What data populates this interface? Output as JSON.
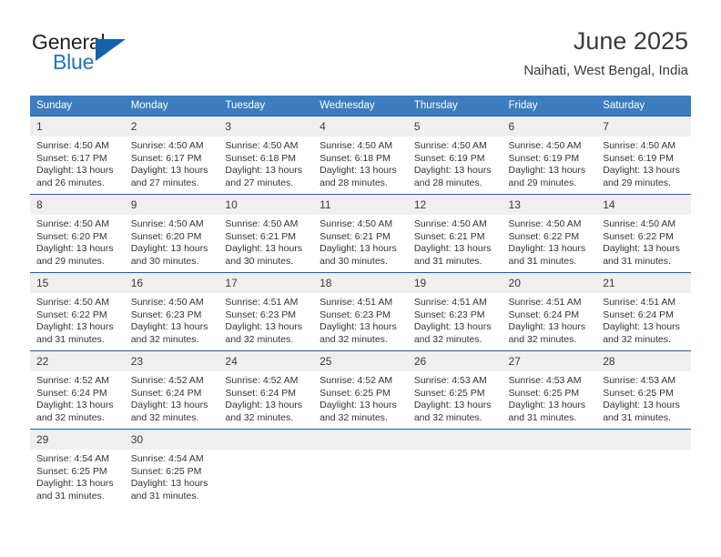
{
  "brand": {
    "name_top": "General",
    "name_bottom": "Blue",
    "triangle_color": "#1161ad",
    "blue_text_color": "#1f76bd"
  },
  "header": {
    "title": "June 2025",
    "subtitle": "Naihati, West Bengal, India"
  },
  "theme": {
    "header_blue": "#3b7dbf",
    "row_divider_blue": "#1b5fa5",
    "daynum_background": "#efefef"
  },
  "calendar": {
    "weekday_headers": [
      "Sunday",
      "Monday",
      "Tuesday",
      "Wednesday",
      "Thursday",
      "Friday",
      "Saturday"
    ],
    "weeks": [
      [
        {
          "day": "1",
          "sunrise": "Sunrise: 4:50 AM",
          "sunset": "Sunset: 6:17 PM",
          "daylight": "Daylight: 13 hours and 26 minutes."
        },
        {
          "day": "2",
          "sunrise": "Sunrise: 4:50 AM",
          "sunset": "Sunset: 6:17 PM",
          "daylight": "Daylight: 13 hours and 27 minutes."
        },
        {
          "day": "3",
          "sunrise": "Sunrise: 4:50 AM",
          "sunset": "Sunset: 6:18 PM",
          "daylight": "Daylight: 13 hours and 27 minutes."
        },
        {
          "day": "4",
          "sunrise": "Sunrise: 4:50 AM",
          "sunset": "Sunset: 6:18 PM",
          "daylight": "Daylight: 13 hours and 28 minutes."
        },
        {
          "day": "5",
          "sunrise": "Sunrise: 4:50 AM",
          "sunset": "Sunset: 6:19 PM",
          "daylight": "Daylight: 13 hours and 28 minutes."
        },
        {
          "day": "6",
          "sunrise": "Sunrise: 4:50 AM",
          "sunset": "Sunset: 6:19 PM",
          "daylight": "Daylight: 13 hours and 29 minutes."
        },
        {
          "day": "7",
          "sunrise": "Sunrise: 4:50 AM",
          "sunset": "Sunset: 6:19 PM",
          "daylight": "Daylight: 13 hours and 29 minutes."
        }
      ],
      [
        {
          "day": "8",
          "sunrise": "Sunrise: 4:50 AM",
          "sunset": "Sunset: 6:20 PM",
          "daylight": "Daylight: 13 hours and 29 minutes."
        },
        {
          "day": "9",
          "sunrise": "Sunrise: 4:50 AM",
          "sunset": "Sunset: 6:20 PM",
          "daylight": "Daylight: 13 hours and 30 minutes."
        },
        {
          "day": "10",
          "sunrise": "Sunrise: 4:50 AM",
          "sunset": "Sunset: 6:21 PM",
          "daylight": "Daylight: 13 hours and 30 minutes."
        },
        {
          "day": "11",
          "sunrise": "Sunrise: 4:50 AM",
          "sunset": "Sunset: 6:21 PM",
          "daylight": "Daylight: 13 hours and 30 minutes."
        },
        {
          "day": "12",
          "sunrise": "Sunrise: 4:50 AM",
          "sunset": "Sunset: 6:21 PM",
          "daylight": "Daylight: 13 hours and 31 minutes."
        },
        {
          "day": "13",
          "sunrise": "Sunrise: 4:50 AM",
          "sunset": "Sunset: 6:22 PM",
          "daylight": "Daylight: 13 hours and 31 minutes."
        },
        {
          "day": "14",
          "sunrise": "Sunrise: 4:50 AM",
          "sunset": "Sunset: 6:22 PM",
          "daylight": "Daylight: 13 hours and 31 minutes."
        }
      ],
      [
        {
          "day": "15",
          "sunrise": "Sunrise: 4:50 AM",
          "sunset": "Sunset: 6:22 PM",
          "daylight": "Daylight: 13 hours and 31 minutes."
        },
        {
          "day": "16",
          "sunrise": "Sunrise: 4:50 AM",
          "sunset": "Sunset: 6:23 PM",
          "daylight": "Daylight: 13 hours and 32 minutes."
        },
        {
          "day": "17",
          "sunrise": "Sunrise: 4:51 AM",
          "sunset": "Sunset: 6:23 PM",
          "daylight": "Daylight: 13 hours and 32 minutes."
        },
        {
          "day": "18",
          "sunrise": "Sunrise: 4:51 AM",
          "sunset": "Sunset: 6:23 PM",
          "daylight": "Daylight: 13 hours and 32 minutes."
        },
        {
          "day": "19",
          "sunrise": "Sunrise: 4:51 AM",
          "sunset": "Sunset: 6:23 PM",
          "daylight": "Daylight: 13 hours and 32 minutes."
        },
        {
          "day": "20",
          "sunrise": "Sunrise: 4:51 AM",
          "sunset": "Sunset: 6:24 PM",
          "daylight": "Daylight: 13 hours and 32 minutes."
        },
        {
          "day": "21",
          "sunrise": "Sunrise: 4:51 AM",
          "sunset": "Sunset: 6:24 PM",
          "daylight": "Daylight: 13 hours and 32 minutes."
        }
      ],
      [
        {
          "day": "22",
          "sunrise": "Sunrise: 4:52 AM",
          "sunset": "Sunset: 6:24 PM",
          "daylight": "Daylight: 13 hours and 32 minutes."
        },
        {
          "day": "23",
          "sunrise": "Sunrise: 4:52 AM",
          "sunset": "Sunset: 6:24 PM",
          "daylight": "Daylight: 13 hours and 32 minutes."
        },
        {
          "day": "24",
          "sunrise": "Sunrise: 4:52 AM",
          "sunset": "Sunset: 6:24 PM",
          "daylight": "Daylight: 13 hours and 32 minutes."
        },
        {
          "day": "25",
          "sunrise": "Sunrise: 4:52 AM",
          "sunset": "Sunset: 6:25 PM",
          "daylight": "Daylight: 13 hours and 32 minutes."
        },
        {
          "day": "26",
          "sunrise": "Sunrise: 4:53 AM",
          "sunset": "Sunset: 6:25 PM",
          "daylight": "Daylight: 13 hours and 32 minutes."
        },
        {
          "day": "27",
          "sunrise": "Sunrise: 4:53 AM",
          "sunset": "Sunset: 6:25 PM",
          "daylight": "Daylight: 13 hours and 31 minutes."
        },
        {
          "day": "28",
          "sunrise": "Sunrise: 4:53 AM",
          "sunset": "Sunset: 6:25 PM",
          "daylight": "Daylight: 13 hours and 31 minutes."
        }
      ],
      [
        {
          "day": "29",
          "sunrise": "Sunrise: 4:54 AM",
          "sunset": "Sunset: 6:25 PM",
          "daylight": "Daylight: 13 hours and 31 minutes."
        },
        {
          "day": "30",
          "sunrise": "Sunrise: 4:54 AM",
          "sunset": "Sunset: 6:25 PM",
          "daylight": "Daylight: 13 hours and 31 minutes."
        },
        {
          "day": "",
          "sunrise": "",
          "sunset": "",
          "daylight": ""
        },
        {
          "day": "",
          "sunrise": "",
          "sunset": "",
          "daylight": ""
        },
        {
          "day": "",
          "sunrise": "",
          "sunset": "",
          "daylight": ""
        },
        {
          "day": "",
          "sunrise": "",
          "sunset": "",
          "daylight": ""
        },
        {
          "day": "",
          "sunrise": "",
          "sunset": "",
          "daylight": ""
        }
      ]
    ]
  }
}
